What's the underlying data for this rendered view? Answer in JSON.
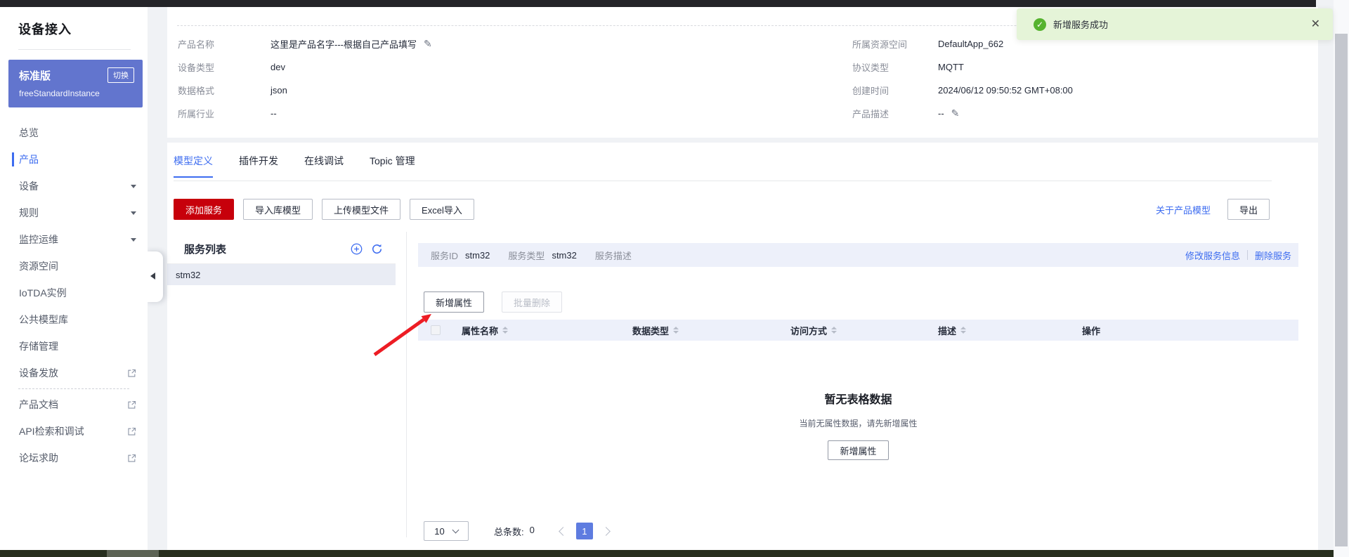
{
  "colors": {
    "accent": "#3d6cf0",
    "danger": "#c7000b",
    "toast_bg": "#e5f4d8",
    "toast_icon": "#55b32e",
    "active_page": "#5e7ce0",
    "annotation_arrow": "#ed1c24"
  },
  "sidebar": {
    "title": "设备接入",
    "card": {
      "edition": "标准版",
      "switch": "切换",
      "instance": "freeStandardInstance"
    },
    "items": [
      {
        "label": "总览"
      },
      {
        "label": "产品"
      },
      {
        "label": "设备"
      },
      {
        "label": "规则"
      },
      {
        "label": "监控运维"
      },
      {
        "label": "资源空间"
      },
      {
        "label": "IoTDA实例"
      },
      {
        "label": "公共模型库"
      },
      {
        "label": "存储管理"
      },
      {
        "label": "设备发放"
      },
      {
        "label": "产品文档"
      },
      {
        "label": "API检索和调试"
      },
      {
        "label": "论坛求助"
      }
    ]
  },
  "toast": {
    "message": "新增服务成功",
    "close": "✕"
  },
  "product": {
    "fields_left": [
      {
        "label": "产品名称",
        "value": "这里是产品名字---根据自己产品填写"
      },
      {
        "label": "设备类型",
        "value": "dev"
      },
      {
        "label": "数据格式",
        "value": "json"
      },
      {
        "label": "所属行业",
        "value": "--"
      }
    ],
    "fields_right": [
      {
        "label": "所属资源空间",
        "value": "DefaultApp_662"
      },
      {
        "label": "协议类型",
        "value": "MQTT"
      },
      {
        "label": "创建时间",
        "value": "2024/06/12 09:50:52 GMT+08:00"
      },
      {
        "label": "产品描述",
        "value": "--"
      }
    ]
  },
  "tabs": [
    {
      "label": "模型定义"
    },
    {
      "label": "插件开发"
    },
    {
      "label": "在线调试"
    },
    {
      "label": "Topic 管理"
    }
  ],
  "toolbar": {
    "add_service": "添加服务",
    "import_model": "导入库模型",
    "upload_model": "上传模型文件",
    "excel_import": "Excel导入",
    "about_link": "关于产品模型",
    "export": "导出"
  },
  "service_list": {
    "title": "服务列表",
    "items": [
      {
        "name": "stm32"
      }
    ]
  },
  "service_bar": {
    "fields": [
      {
        "label": "服务ID",
        "value": "stm32"
      },
      {
        "label": "服务类型",
        "value": "stm32"
      },
      {
        "label": "服务描述",
        "value": ""
      }
    ],
    "edit_action": "修改服务信息",
    "delete_action": "删除服务"
  },
  "properties": {
    "add_button": "新增属性",
    "batch_delete_button": "批量删除",
    "columns": [
      "属性名称",
      "数据类型",
      "访问方式",
      "描述",
      "操作"
    ],
    "empty_title": "暂无表格数据",
    "empty_hint": "当前无属性数据，请先新增属性",
    "empty_action": "新增属性"
  },
  "pagination": {
    "page_size": "10",
    "total_label": "总条数:",
    "total_value": "0",
    "page": "1"
  }
}
